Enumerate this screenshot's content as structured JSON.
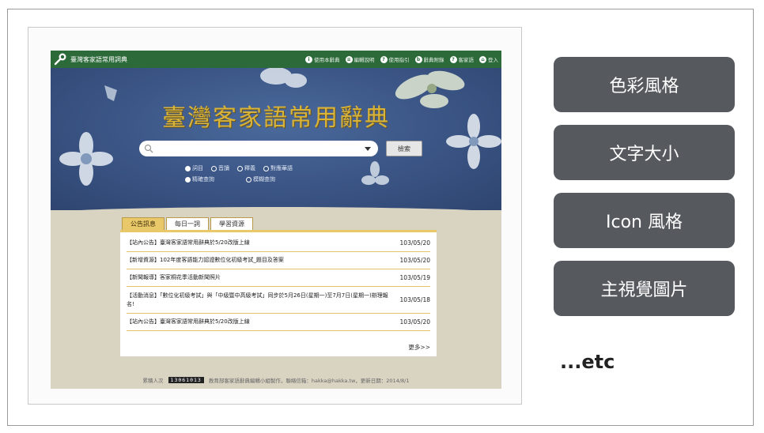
{
  "site": {
    "name": "臺灣客家語常用詞典",
    "nav": [
      "使用本辭典",
      "編輯說明",
      "使用指引",
      "辭典附錄",
      "客家語",
      "登入"
    ],
    "hero_title": "臺灣客家語常用辭典",
    "search": {
      "placeholder": "",
      "button_label": "檢索"
    },
    "options": {
      "row1": [
        "詞目",
        "音讀",
        "釋義",
        "對應華語"
      ],
      "row2": [
        "精確查詢",
        "模糊查詢"
      ]
    },
    "tabs": [
      "公告訊息",
      "每日一詞",
      "學習資源"
    ],
    "news": [
      {
        "text": "【站內公告】臺灣客家語常用辭典於5/20改版上線",
        "date": "103/05/20"
      },
      {
        "text": "【新增資源】102年度客語能力認證數位化初級考試_題目及答案",
        "date": "103/05/20"
      },
      {
        "text": "【新聞報導】客家桐花季活動新聞照片",
        "date": "103/05/19"
      },
      {
        "text": "【活動消息】「數位化初級考試」與「中級暨中高級考試」同步於5月26日(星期一)至7月7日(星期一)辦理報名!",
        "date": "103/05/18"
      },
      {
        "text": "【站內公告】臺灣客家語常用辭典於5/20改版上線",
        "date": "103/05/20"
      }
    ],
    "more": "更多>>",
    "footer": {
      "visitors_label": "累積人次",
      "counter": "13061013",
      "credit": "教育部客家語辭典編輯小組製作，聯絡信箱：hakka@hakka.tw，更新日期：2014/8/1"
    }
  },
  "cards": [
    "色彩風格",
    "文字大小",
    "Icon 風格",
    "主視覺圖片"
  ],
  "etc": "...etc",
  "colors": {
    "topbar": "#2c6a3a",
    "hero": "#3a5484",
    "gold": "#d8b43a",
    "card": "#565a5f"
  }
}
